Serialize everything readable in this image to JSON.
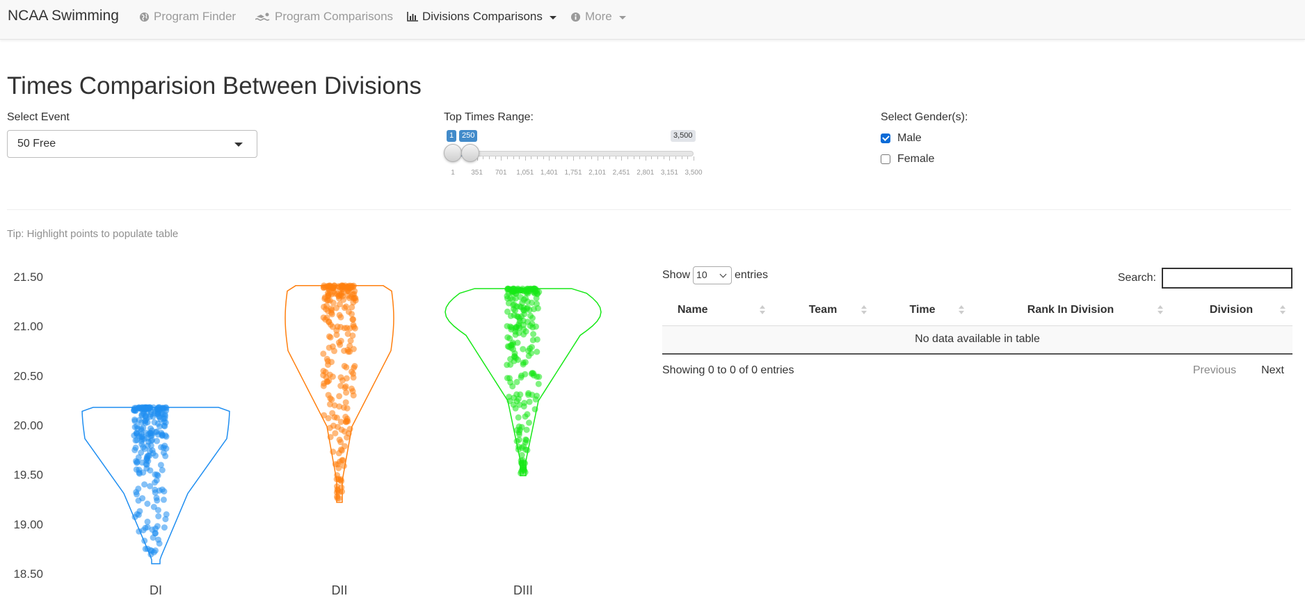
{
  "navbar": {
    "brand": "NCAA Swimming",
    "items": [
      {
        "label": "Program Finder",
        "icon": "globe-icon"
      },
      {
        "label": "Program Comparisons",
        "icon": "swimmer-icon"
      },
      {
        "label": "Divisions Comparisons",
        "icon": "bar-chart-icon",
        "active": true
      },
      {
        "label": "More",
        "icon": "info-circle-icon"
      }
    ]
  },
  "page": {
    "title": "Times Comparision Between Divisions",
    "tip": "Tip: Highlight points to populate table"
  },
  "controls": {
    "event_label": "Select Event",
    "event_value": "50 Free",
    "range_label": "Top Times Range:",
    "range_from": "1",
    "range_to": "250",
    "range_max": "3,500",
    "range_from_frac": 0.0,
    "range_to_frac": 0.071,
    "range_ticks": [
      "1",
      "351",
      "701",
      "1,051",
      "1,401",
      "1,751",
      "2,101",
      "2,451",
      "2,801",
      "3,151",
      "3,500"
    ],
    "gender_label": "Select Gender(s):",
    "genders": [
      {
        "label": "Male",
        "checked": true
      },
      {
        "label": "Female",
        "checked": false
      }
    ]
  },
  "table": {
    "show_label": "Show",
    "length_value": "10",
    "entries_label": "entries",
    "search_label": "Search:",
    "columns": [
      "Name",
      "Team",
      "Time",
      "Rank In Division",
      "Division"
    ],
    "empty_message": "No data available in table",
    "info": "Showing 0 to 0 of 0 entries",
    "prev_label": "Previous",
    "next_label": "Next"
  },
  "chart_data": {
    "type": "violin+scatter",
    "categories": [
      "DI",
      "DII",
      "DIII"
    ],
    "colors": [
      "#1f8ef1",
      "#ff7f0e",
      "#17e817"
    ],
    "yticks": [
      "21.50",
      "21.00",
      "20.50",
      "20.00",
      "19.50",
      "19.00",
      "18.50"
    ],
    "ylim": [
      18.5,
      21.5
    ],
    "series": [
      {
        "min": 18.6,
        "max": 20.18
      },
      {
        "min": 19.22,
        "max": 21.41
      },
      {
        "min": 19.49,
        "max": 21.38
      }
    ]
  }
}
